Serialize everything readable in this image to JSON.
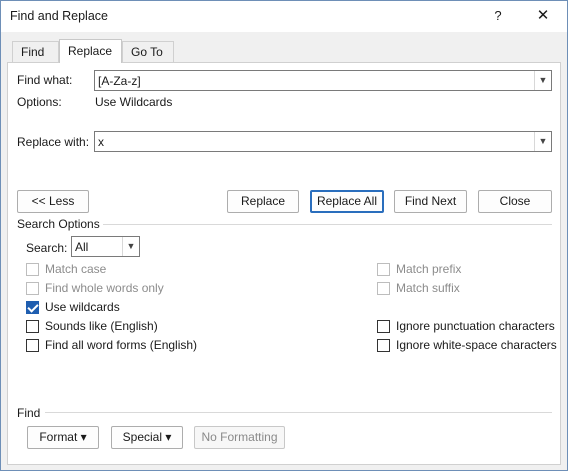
{
  "window": {
    "title": "Find and Replace",
    "help_glyph": "?",
    "close_glyph": "✕"
  },
  "tabs": [
    {
      "label": "Find"
    },
    {
      "label": "Replace"
    },
    {
      "label": "Go To"
    }
  ],
  "find": {
    "label": "Find what:",
    "value": "[A-Za-z]",
    "options_label": "Options:",
    "options_value": "Use Wildcards"
  },
  "replace": {
    "label": "Replace with:",
    "value": "x"
  },
  "buttons": {
    "less": "<< Less",
    "replace": "Replace",
    "replace_all": "Replace All",
    "find_next": "Find Next",
    "close": "Close"
  },
  "search_options": {
    "heading": "Search Options",
    "search_label": "Search:",
    "search_value": "All",
    "checkboxes_left": [
      {
        "label": "Match case",
        "checked": false,
        "disabled": true
      },
      {
        "label": "Find whole words only",
        "checked": false,
        "disabled": true
      },
      {
        "label": "Use wildcards",
        "checked": true,
        "disabled": false
      },
      {
        "label": "Sounds like (English)",
        "checked": false,
        "disabled": false
      },
      {
        "label": "Find all word forms (English)",
        "checked": false,
        "disabled": false
      }
    ],
    "checkboxes_right": [
      {
        "label": "Match prefix",
        "checked": false,
        "disabled": true
      },
      {
        "label": "Match suffix",
        "checked": false,
        "disabled": true
      },
      {
        "label": "Ignore punctuation characters",
        "checked": false,
        "disabled": false
      },
      {
        "label": "Ignore white-space characters",
        "checked": false,
        "disabled": false
      }
    ]
  },
  "find_section": {
    "heading": "Find",
    "format": "Format ▾",
    "special": "Special ▾",
    "no_formatting": "No Formatting"
  }
}
